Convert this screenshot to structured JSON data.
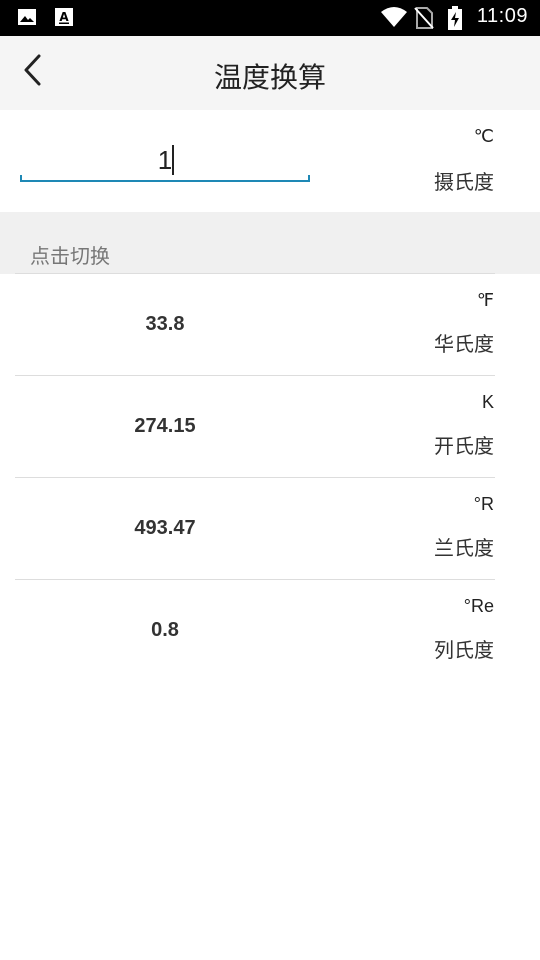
{
  "status_bar": {
    "time": "11:09",
    "icons": [
      "image-icon",
      "text-app-icon",
      "wifi-icon",
      "no-sim-icon",
      "battery-charging-icon"
    ]
  },
  "header": {
    "title": "温度换算",
    "back_icon": "chevron-left-icon"
  },
  "input": {
    "value": "1",
    "unit_symbol": "℃",
    "unit_name": "摄氏度"
  },
  "section": {
    "label": "点击切换"
  },
  "results": [
    {
      "value": "33.8",
      "unit_symbol": "℉",
      "unit_name": "华氏度"
    },
    {
      "value": "274.15",
      "unit_symbol": "K",
      "unit_name": "开氏度"
    },
    {
      "value": "493.47",
      "unit_symbol": "°R",
      "unit_name": "兰氏度"
    },
    {
      "value": "0.8",
      "unit_symbol": "°Re",
      "unit_name": "列氏度"
    }
  ],
  "colors": {
    "status_bar": "#000000",
    "title_bar": "#f5f5f5",
    "section_bg": "#f0f0f0",
    "accent_underline": "#1e88b5",
    "divider": "#dddddd"
  }
}
